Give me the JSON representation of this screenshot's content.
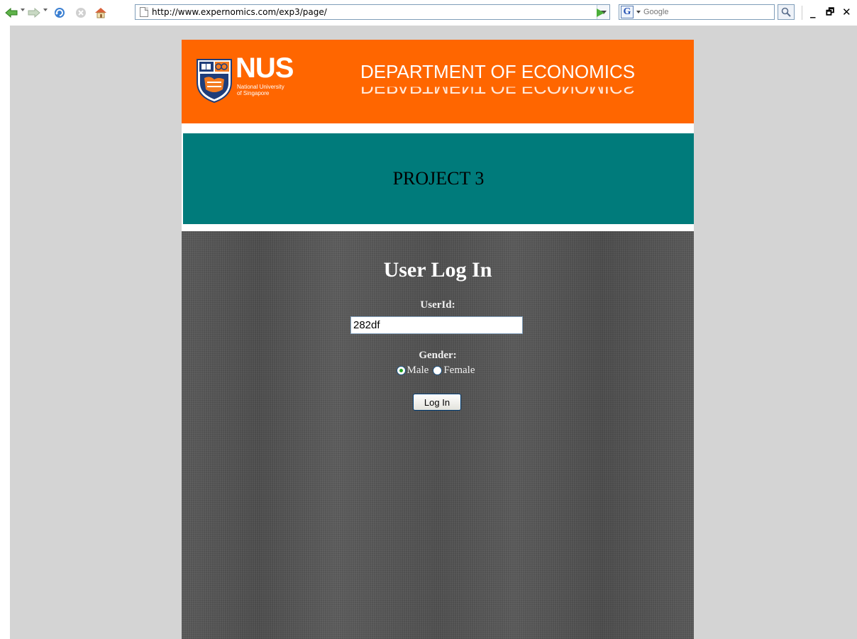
{
  "browser": {
    "url": "http://www.expernomics.com/exp3/page/",
    "search_placeholder": "Google",
    "window_controls": [
      "_",
      "🗗",
      "✕"
    ]
  },
  "header": {
    "logo_text": "NUS",
    "logo_subtitle_line1": "National University",
    "logo_subtitle_line2": "of Singapore",
    "department": "DEPARTMENT OF ECONOMICS",
    "project_title": "PROJECT 3"
  },
  "login": {
    "title": "User Log In",
    "userid_label": "UserId:",
    "userid_value": "282df",
    "gender_label": "Gender:",
    "gender_options": [
      "Male",
      "Female"
    ],
    "gender_selected": "Male",
    "submit_label": "Log In"
  },
  "colors": {
    "orange_header": "#ff6600",
    "teal_header": "#007b7b",
    "page_background": "#d4d4d4"
  }
}
